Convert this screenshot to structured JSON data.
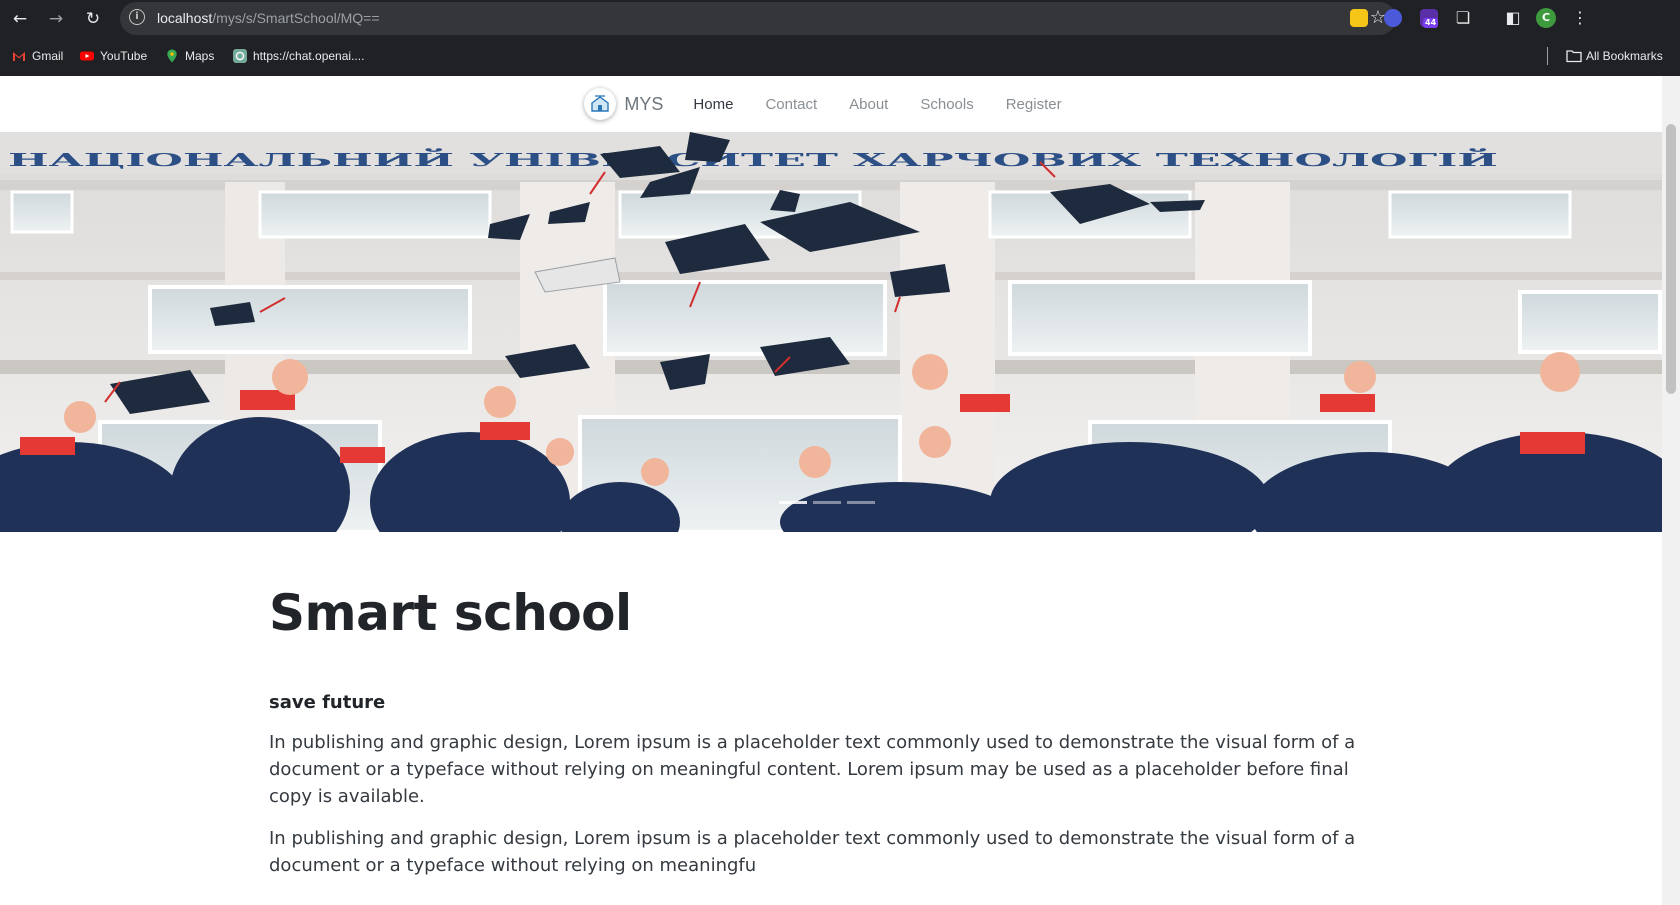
{
  "browser": {
    "url_host": "localhost",
    "url_path": "/mys/s/SmartSchool/MQ==",
    "extension_badge": "44",
    "profile_initial": "C",
    "bookmarks": [
      {
        "label": "Gmail",
        "icon": "gmail-icon",
        "color": "#ea4335"
      },
      {
        "label": "YouTube",
        "icon": "youtube-icon",
        "color": "#ff0000"
      },
      {
        "label": "Maps",
        "icon": "maps-icon",
        "color": "#34a853"
      },
      {
        "label": "https://chat.openai....",
        "icon": "chatgpt-icon",
        "color": "#74aa9c"
      }
    ],
    "all_bookmarks_label": "All Bookmarks"
  },
  "site": {
    "brand": "MYS",
    "nav": [
      {
        "label": "Home",
        "active": true
      },
      {
        "label": "Contact",
        "active": false
      },
      {
        "label": "About",
        "active": false
      },
      {
        "label": "Schools",
        "active": false
      },
      {
        "label": "Register",
        "active": false
      }
    ],
    "hero": {
      "building_sign": "НАЦІОНАЛЬНИЙ УНІВЕРСИТЕТ ХАРЧОВИХ ТЕХНОЛОГІЙ",
      "slide_count": 3,
      "active_slide": 1
    }
  },
  "main": {
    "title": "Smart school",
    "subtitle": "save future",
    "paragraphs": [
      "In publishing and graphic design, Lorem ipsum is a placeholder text commonly used to demonstrate the visual form of a document or a typeface without relying on meaningful content. Lorem ipsum may be used as a placeholder before final copy is available.",
      "In publishing and graphic design, Lorem ipsum is a placeholder text commonly used to demonstrate the visual form of a document or a typeface without relying on meaningfu"
    ]
  }
}
